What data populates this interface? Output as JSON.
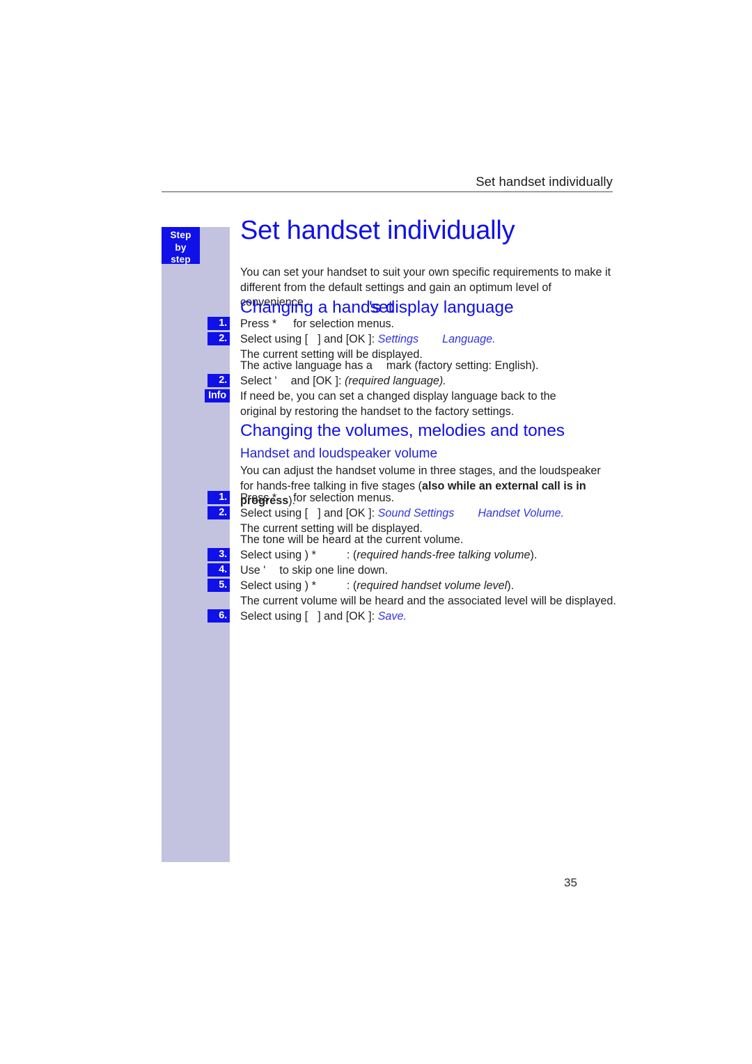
{
  "page": {
    "running_header": "Set handset individually",
    "folio": "35",
    "colors": {
      "heading_blue": "#1010e8",
      "band_lavender": "#c3c3e0",
      "badge_blue": "#1010e8",
      "body_black": "#1f1f1f",
      "italic_blue": "#3434dd"
    }
  },
  "sidebar": {
    "tab": {
      "line1": "Step",
      "line2": "by",
      "line3": "step"
    },
    "badges": [
      {
        "label": "1."
      },
      {
        "label": "2."
      },
      {
        "label": "2."
      },
      {
        "label": "Info"
      },
      {
        "label": "1."
      },
      {
        "label": "2."
      },
      {
        "label": "3."
      },
      {
        "label": "4."
      },
      {
        "label": "5."
      },
      {
        "label": "6."
      }
    ]
  },
  "main": {
    "title": "Set handset individually",
    "intro": "You can set your handset to suit your own specific requirements to make it different from the default settings and gain an optimum level of convenience.",
    "section1": {
      "heading_part_a": "Changing a handset",
      "heading_part_b": "'s display language",
      "heading_full": "Changing a handset's display language",
      "steps": [
        {
          "badge": "1.",
          "text_before": "Press *",
          "text_after": "for selection menus."
        },
        {
          "badge": "2.",
          "text_before": "Select using [",
          "text_mid": "] and [OK ]:",
          "menu1": "Settings",
          "menu2": "Language",
          "text_end": ".",
          "note": "The current setting will be displayed."
        }
      ],
      "note_active_language_a": "The active language has a",
      "note_active_language_b": "mark (factory setting: English).",
      "step_select": {
        "badge": "2.",
        "text_before": "Select '",
        "text_mid": "and [OK ]:",
        "italic": "(required language)",
        "text_end": "."
      },
      "info": {
        "badge": "Info",
        "text": "If need be, you can set a changed display language back to the original by restoring the handset to the factory settings."
      }
    },
    "section2": {
      "heading": "Changing the volumes, melodies and tones",
      "subheading": "Handset and loudspeaker volume",
      "intro_a": "You can adjust the handset volume in three stages, and the loudspeaker for hands-free talking in five stages (",
      "intro_bold": "also while an external call is in progress",
      "intro_b": ").",
      "steps": [
        {
          "badge": "1.",
          "text_before": "Press *",
          "text_after": "for selection menus."
        },
        {
          "badge": "2.",
          "text_before": "Select using [",
          "text_mid": "] and [OK ]:",
          "menu1": "Sound Settings",
          "menu2": "Handset Volume",
          "text_end": ".",
          "note": "The current setting will be displayed."
        }
      ],
      "note_tone": "The tone will be heard at the current volume.",
      "step3": {
        "badge": "3.",
        "text_before": "Select using ) *",
        "text_mid": ": (",
        "italic": "required hands-free talking volume",
        "text_end": ")."
      },
      "step4": {
        "badge": "4.",
        "text_before": "Use '",
        "text_after": "to skip one line down."
      },
      "step5": {
        "badge": "5.",
        "text_before": "Select using ) *",
        "text_mid": ": (",
        "italic": "required handset volume level",
        "text_end": ")."
      },
      "note_volume": "The current volume will be heard and the associated level will be displayed.",
      "step6": {
        "badge": "6.",
        "text_before": "Select using [",
        "text_mid": "] and [OK ]:",
        "menu1": "Save",
        "text_end": "."
      }
    }
  }
}
